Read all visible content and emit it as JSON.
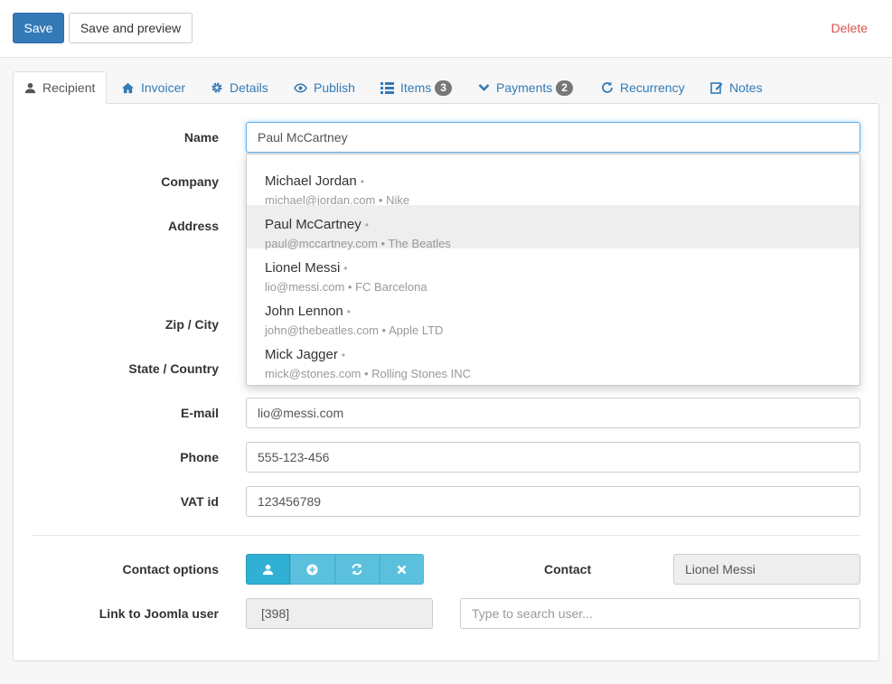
{
  "toolbar": {
    "save_label": "Save",
    "preview_label": "Save and preview",
    "delete_label": "Delete"
  },
  "tabs": [
    {
      "label": "Recipient",
      "icon": "user-icon"
    },
    {
      "label": "Invoicer",
      "icon": "home-icon"
    },
    {
      "label": "Details",
      "icon": "gear-icon"
    },
    {
      "label": "Publish",
      "icon": "eye-icon"
    },
    {
      "label": "Items",
      "icon": "list-icon",
      "badge": "3"
    },
    {
      "label": "Payments",
      "icon": "chevron-down-icon",
      "badge": "2"
    },
    {
      "label": "Recurrency",
      "icon": "refresh-icon"
    },
    {
      "label": "Notes",
      "icon": "edit-icon"
    }
  ],
  "form": {
    "name_label": "Name",
    "name_value": "Paul McCartney",
    "company_label": "Company",
    "address_label": "Address",
    "zip_city_label": "Zip / City",
    "state_country_label": "State / Country",
    "email_label": "E-mail",
    "email_value": "lio@messi.com",
    "phone_label": "Phone",
    "phone_value": "555-123-456",
    "vat_label": "VAT id",
    "vat_value": "123456789",
    "contact_options_label": "Contact options",
    "contact_label": "Contact",
    "contact_value": "Lionel Messi",
    "joomla_label": "Link to Joomla user",
    "joomla_value": "[398]",
    "joomla_search_placeholder": "Type to search user..."
  },
  "suggestions": [
    {
      "name": "Michael Jordan",
      "dot": "•",
      "sub": "michael@jordan.com • Nike"
    },
    {
      "name": "Paul McCartney",
      "dot": "•",
      "sub": "paul@mccartney.com • The Beatles"
    },
    {
      "name": "Lionel Messi",
      "dot": "•",
      "sub": "lio@messi.com • FC Barcelona"
    },
    {
      "name": "John Lennon",
      "dot": "•",
      "sub": "john@thebeatles.com • Apple LTD"
    },
    {
      "name": "Mick Jagger",
      "dot": "•",
      "sub": "mick@stones.com • Rolling Stones INC"
    }
  ],
  "colors": {
    "primary": "#337ab7",
    "info": "#5bc0de",
    "danger": "#d9534f"
  }
}
